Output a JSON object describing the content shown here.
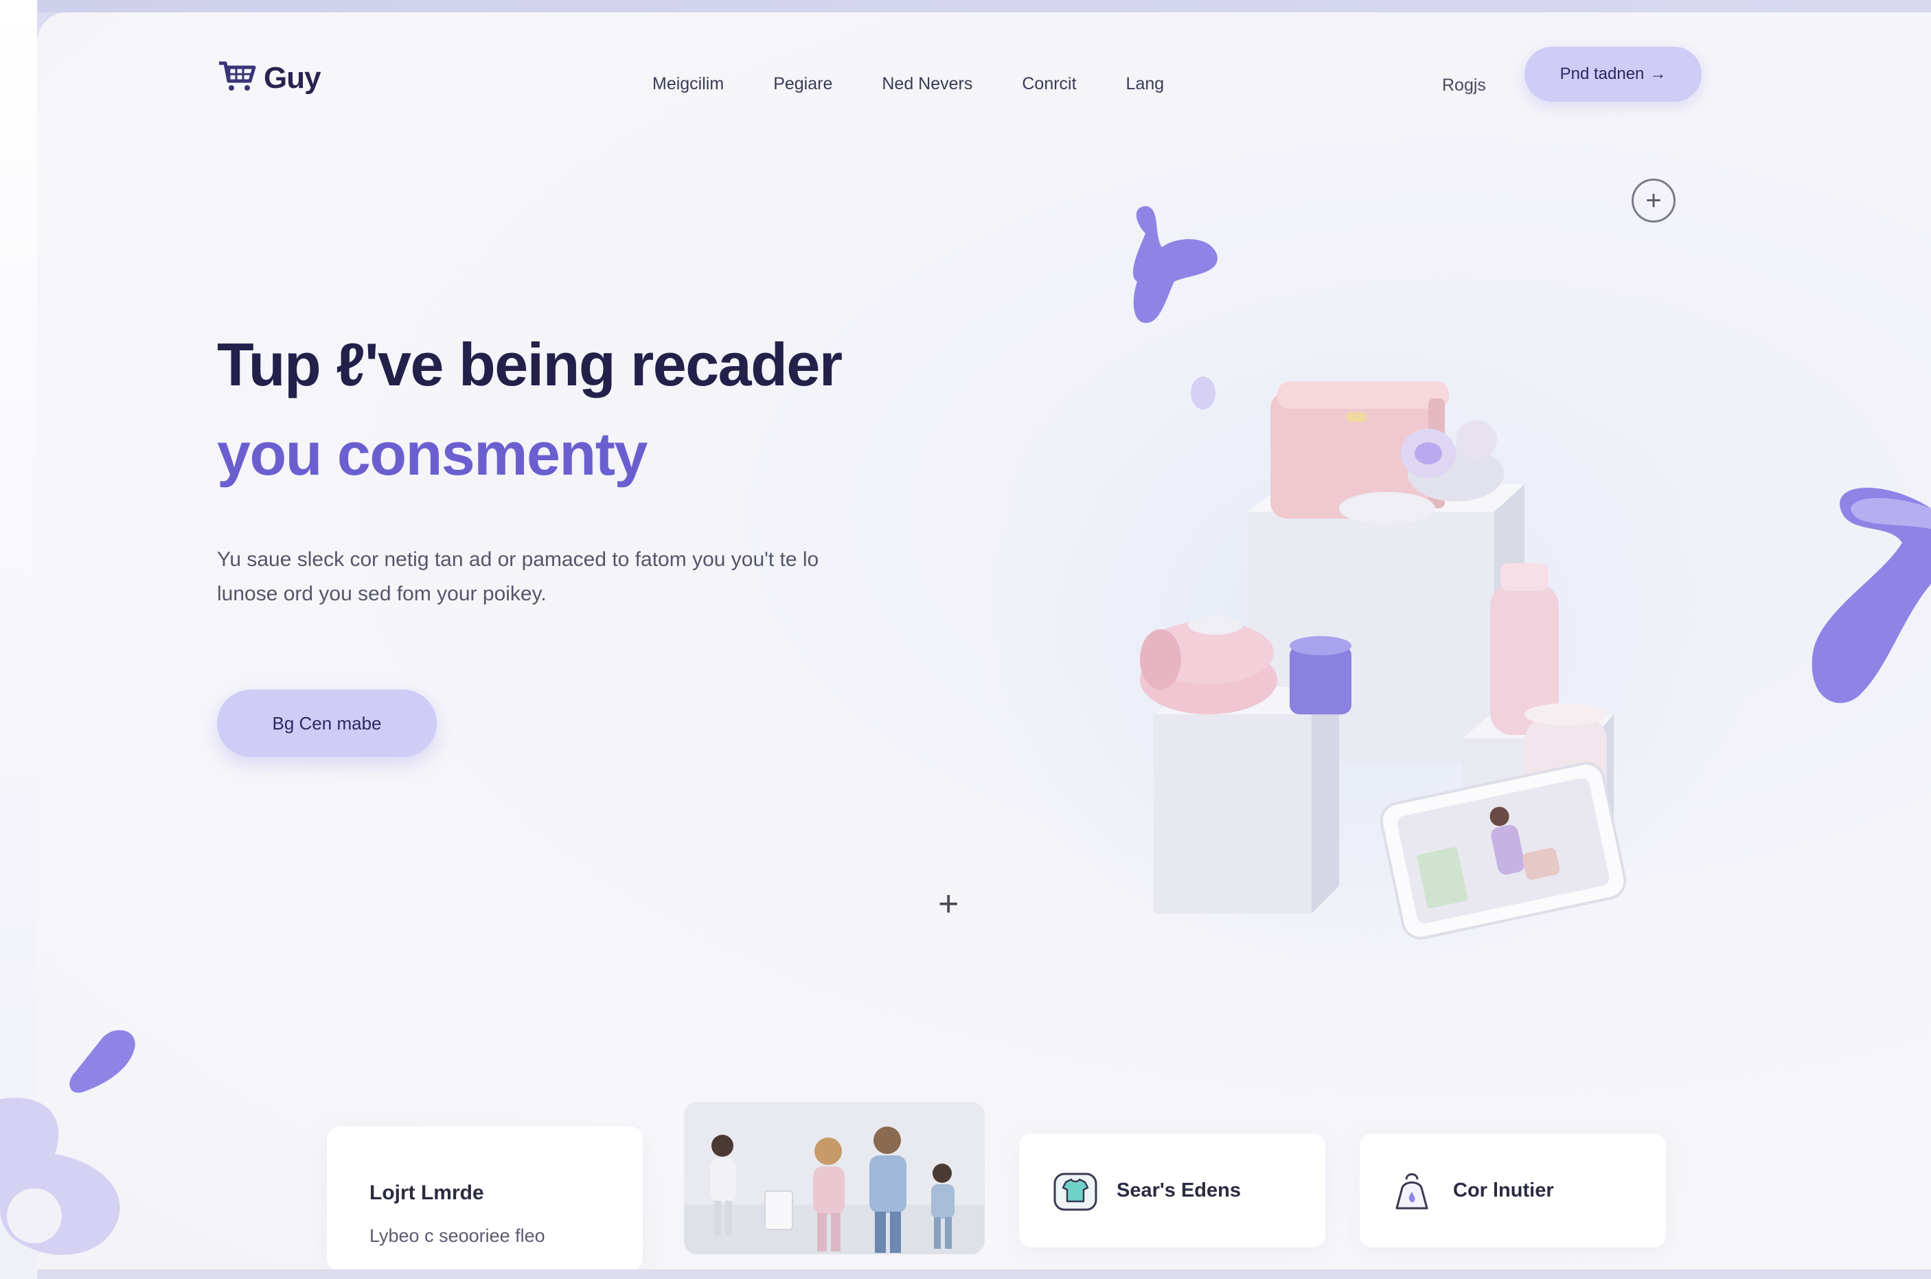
{
  "brand": {
    "name": "Guy",
    "logo_icon": "shopping-cart-icon"
  },
  "nav": {
    "links": [
      "Meigcilim",
      "Pegiare",
      "Ned Nevers",
      "Conrcit",
      "Lang"
    ],
    "login": "Rogjs",
    "cta": "Pnd tadnen",
    "cta_arrow": "→"
  },
  "hero": {
    "headline_line1": "Tup ℓ've being recader",
    "headline_line2": "you consmenty",
    "description": "Yu saue sleck cor netig tan ad or pamaced to fatom you you't te lo lunose ord you sed fom your poikey.",
    "cta": "Bg Cen mabe"
  },
  "controls": {
    "add_circle": "+",
    "add_small": "+"
  },
  "cards": [
    {
      "title": "Lojrt Lmrde",
      "subtitle": "Lybeo c seooriee fleo"
    },
    {
      "image": "family-photo"
    },
    {
      "label": "Sear's Edens",
      "icon": "shirt-icon"
    },
    {
      "label": "Cor lnutier",
      "icon": "bag-icon"
    }
  ],
  "colors": {
    "accent": "#6b5fd0",
    "accent_soft": "#cfcdf6",
    "headline": "#23204a",
    "blob": "#8f83e6",
    "background": "#f4f4f9"
  }
}
